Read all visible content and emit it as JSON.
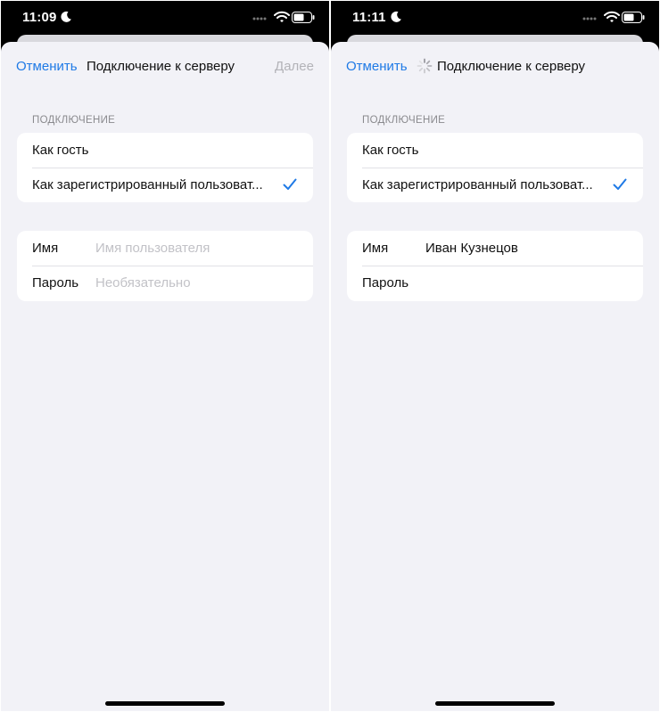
{
  "screens": [
    {
      "status": {
        "time": "11:09"
      },
      "nav": {
        "cancel": "Отменить",
        "title": "Подключение к серверу",
        "next": "Далее"
      },
      "section_header": "ПОДКЛЮЧЕНИЕ",
      "options": [
        {
          "label": "Как гость",
          "selected": false
        },
        {
          "label": "Как зарегистрированный пользоват...",
          "selected": true
        }
      ],
      "fields": [
        {
          "label": "Имя",
          "value": "",
          "placeholder": "Имя пользователя"
        },
        {
          "label": "Пароль",
          "value": "",
          "placeholder": "Необязательно"
        }
      ]
    },
    {
      "status": {
        "time": "11:11"
      },
      "nav": {
        "cancel": "Отменить",
        "title": "Подключение к серверу",
        "loading": true
      },
      "section_header": "ПОДКЛЮЧЕНИЕ",
      "options": [
        {
          "label": "Как гость",
          "selected": false
        },
        {
          "label": "Как зарегистрированный пользоват...",
          "selected": true
        }
      ],
      "fields": [
        {
          "label": "Имя",
          "value": "Иван Кузнецов",
          "placeholder": ""
        },
        {
          "label": "Пароль",
          "value": "",
          "placeholder": ""
        }
      ]
    }
  ],
  "colors": {
    "accent": "#1f7ae6",
    "disabled": "#b3b3b8",
    "background": "#f2f2f7",
    "secondary_text": "#8a8a8e",
    "placeholder": "#c2c2c7"
  },
  "icons": [
    "moon-icon",
    "cellular-dots-icon",
    "wifi-icon",
    "battery-icon",
    "checkmark-icon",
    "activity-spinner-icon"
  ]
}
